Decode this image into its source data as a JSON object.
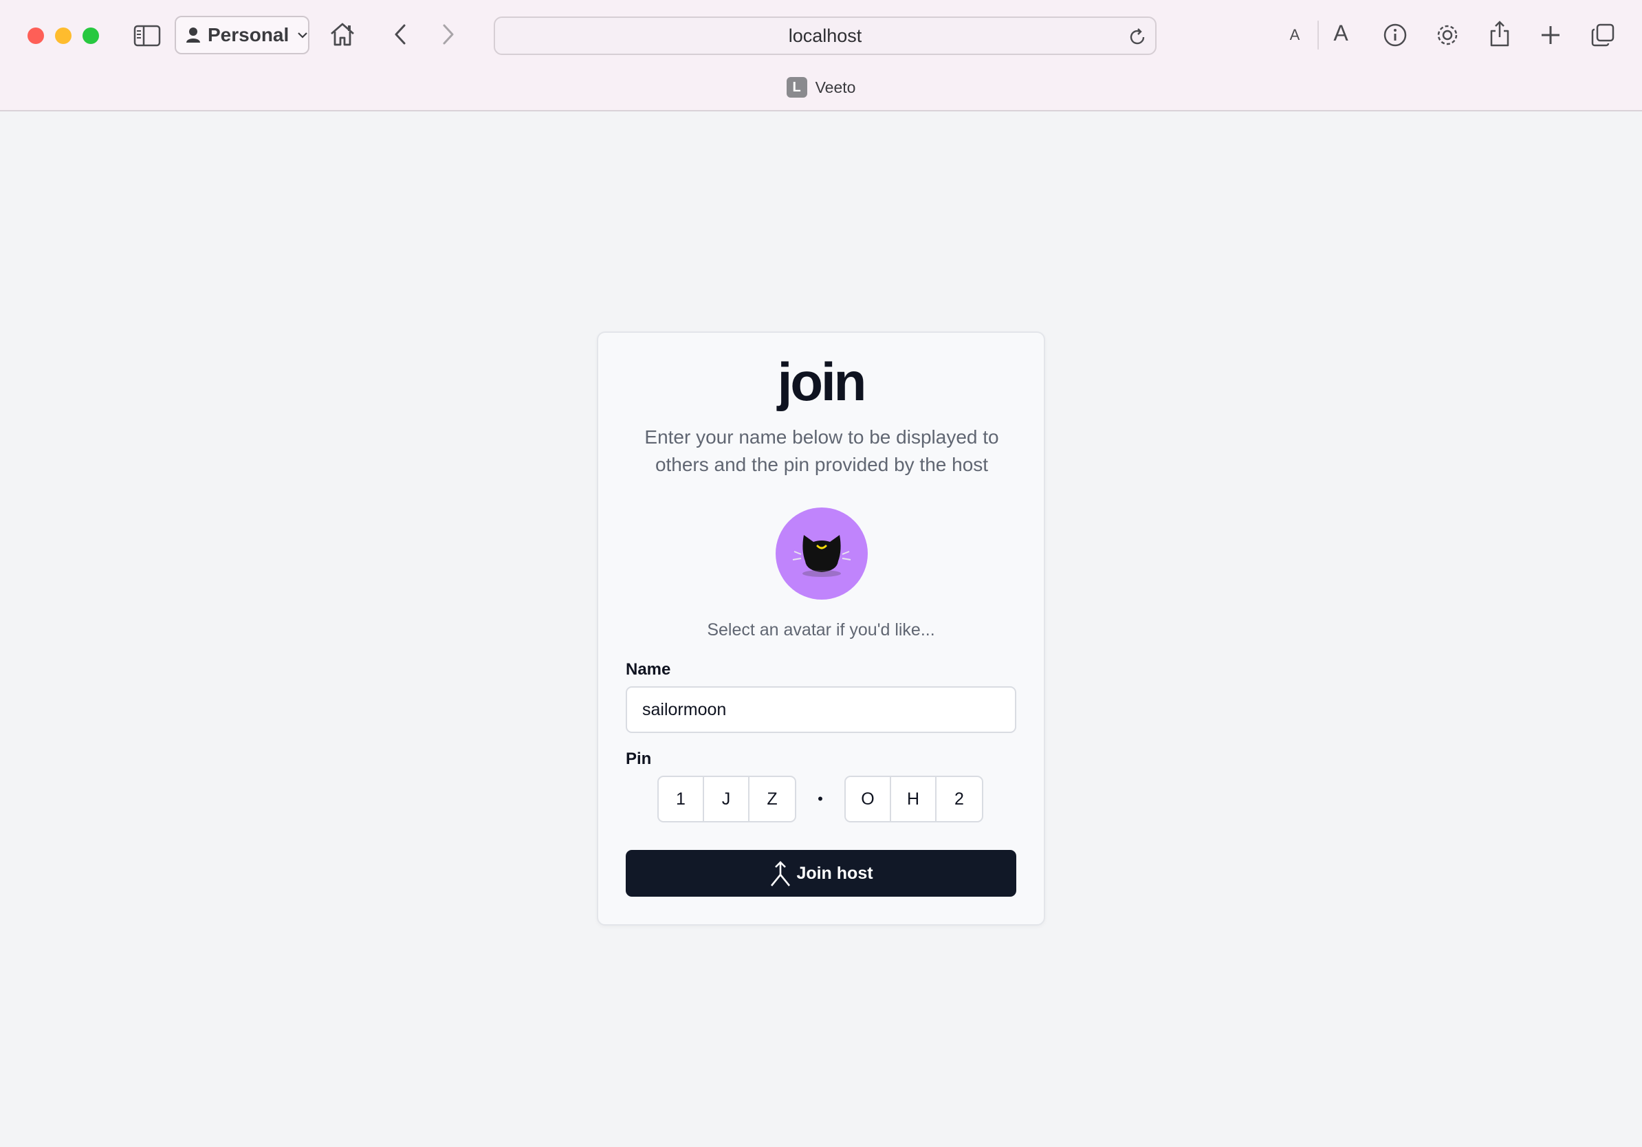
{
  "browser": {
    "profile_label": "Personal",
    "address": "localhost",
    "tab_title": "Veeto",
    "tab_favicon_letter": "L",
    "font_small_label": "A",
    "font_large_label": "A",
    "icons": [
      "sidebar-icon",
      "person-icon",
      "chevron-down-icon",
      "home-icon",
      "back-icon",
      "forward-icon",
      "reload-icon",
      "info-icon",
      "gear-icon",
      "share-icon",
      "plus-icon",
      "tabs-overview-icon"
    ]
  },
  "join_card": {
    "title": "join",
    "subtitle": "Enter your name below to be displayed to others and the pin provided by the host",
    "avatar_hint": "Select an avatar if you'd like...",
    "avatar_color": "#c084fc",
    "name_label": "Name",
    "name_value": "sailormoon",
    "pin_label": "Pin",
    "pin_first": [
      "1",
      "J",
      "Z"
    ],
    "pin_separator": "•",
    "pin_second": [
      "O",
      "H",
      "2"
    ],
    "submit_label": "Join host",
    "submit_color": "#111827"
  }
}
